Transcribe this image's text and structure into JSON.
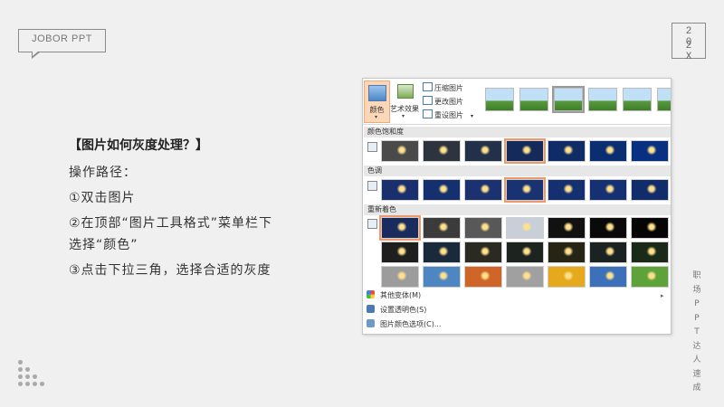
{
  "logo": {
    "text": "JOBOR PPT"
  },
  "year": {
    "row1": "2 0",
    "row2": "2 X"
  },
  "side_vertical": [
    "职",
    "场",
    "P",
    "P",
    "T",
    "达",
    "人",
    "速",
    "成"
  ],
  "content": {
    "title": "【图片如何灰度处理？】",
    "path_label": "操作路径：",
    "step1": "①双击图片",
    "step2a": "②在顶部“图片工具格式”菜单栏下",
    "step2b": "选择“颜色”",
    "step3": "③点击下拉三角，选择合适的灰度"
  },
  "ribbon": {
    "color_btn": "颜色",
    "art_btn": "艺术效果",
    "compress": "压缩图片",
    "change": "更改图片",
    "reset": "重设图片"
  },
  "sections": {
    "saturation": "颜色饱和度",
    "tone": "色调",
    "recolor": "重新着色"
  },
  "menu": {
    "more_variants": "其他变体(M)",
    "transparent": "设置透明色(S)",
    "options": "图片颜色选项(C)..."
  },
  "colors": {
    "selection_border": "#f09a6c",
    "active_button": "#fbd7b8",
    "section_bg": "#e7e7e7",
    "saturation_row": [
      "#4a4a4a",
      "#2d3440",
      "#22304a",
      "#142a5a",
      "#0f2c66",
      "#0b2e73",
      "#082f80"
    ],
    "tone_row": [
      "#1a2f6e",
      "#14306f",
      "#1b3170",
      "#193272",
      "#153070",
      "#163173",
      "#102c6a"
    ],
    "recolor_row1": [
      "#1a2b5e",
      "#3b3b3b",
      "#585858",
      "#c8cfd8",
      "#111111",
      "#0a0a0a",
      "#050505"
    ],
    "recolor_row2": [
      "#1e1e1e",
      "#1b2a3a",
      "#2a2a22",
      "#1d2420",
      "#262414",
      "#1a2222",
      "#1a2a18"
    ],
    "recolor_row3": [
      "#9c9c9c",
      "#4e86c2",
      "#d0652a",
      "#a0a0a0",
      "#e6a81c",
      "#3c70b8",
      "#5da33a"
    ]
  }
}
